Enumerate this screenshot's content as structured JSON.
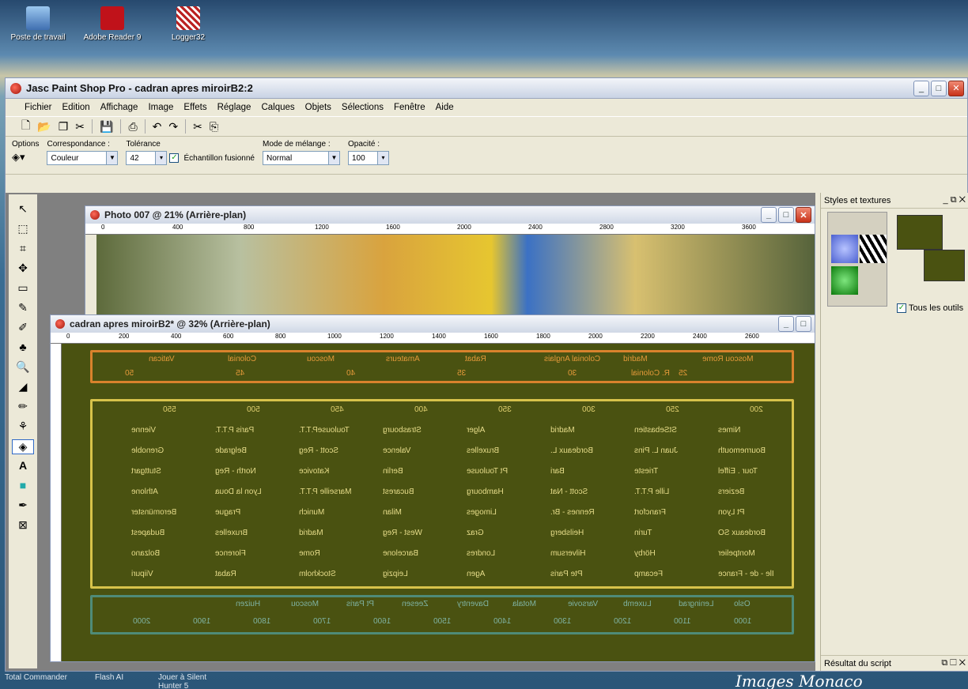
{
  "desktop": {
    "icons": [
      {
        "label": "Poste de travail"
      },
      {
        "label": "Adobe Reader 9"
      },
      {
        "label": "Logger32"
      }
    ],
    "taskbar": [
      "Total Commander",
      "Flash AI",
      "Jouer à Silent Hunter 5"
    ],
    "logo_text": "Images Monaco"
  },
  "app": {
    "title": "Jasc Paint Shop Pro - cadran apres miroirB2:2",
    "menu": [
      "Fichier",
      "Edition",
      "Affichage",
      "Image",
      "Effets",
      "Réglage",
      "Calques",
      "Objets",
      "Sélections",
      "Fenêtre",
      "Aide"
    ],
    "options": {
      "options_label": "Options",
      "match_label": "Correspondance :",
      "match_value": "Couleur",
      "tolerance_label": "Tolérance",
      "tolerance_value": "42",
      "sample_merged": "Échantillon fusionné",
      "blend_label": "Mode de mélange :",
      "blend_value": "Normal",
      "opacity_label": "Opacité :",
      "opacity_value": "100"
    }
  },
  "photo_window": {
    "title": "Photo 007 @  21% (Arrière-plan)",
    "ruler": [
      "0",
      "400",
      "800",
      "1200",
      "1600",
      "2000",
      "2400",
      "2800",
      "3200",
      "3600"
    ]
  },
  "dial_window": {
    "title": "cadran apres miroirB2* @  32% (Arrière-plan)",
    "ruler": [
      "0",
      "200",
      "400",
      "600",
      "800",
      "1000",
      "1200",
      "1400",
      "1600",
      "1800",
      "2000",
      "2200",
      "2400",
      "2600"
    ],
    "top_band": [
      "Moscou Rome",
      "Madrid",
      "Colonial Anglais",
      "Rabat",
      "Amateurs",
      "Moscou",
      "Colonial",
      "Vatican"
    ],
    "top_scale": [
      "25",
      "30",
      "35",
      "40",
      "45",
      "50"
    ],
    "top_extra": "R. Colonial",
    "main_scale": [
      "200",
      "250",
      "300",
      "350",
      "400",
      "450",
      "500",
      "550"
    ],
    "rows": [
      [
        "Nimes",
        "StSebastien",
        "Madrid",
        "Alger",
        "Strasbourg",
        "ToulouseP.T.T.",
        "Paris P.T.T.",
        "Vienne"
      ],
      [
        "Bournemouth",
        "Juan L. Pins",
        "Bordeaux L.",
        "Bruxelles",
        "Valence",
        "Scott - Reg",
        "Belgrade",
        "Grenoble"
      ],
      [
        "Tour . Eiffel",
        "Trieste",
        "Bari",
        "Pt Toulouse",
        "Berlin",
        "Katovice",
        "North - Reg",
        "Stuttgart"
      ],
      [
        "Beziers",
        "Lille P.T.T.",
        "Scott - Nat",
        "Hambourg",
        "Bucarest",
        "Marseille P.T.T.",
        "Lyon la Doua",
        "Athlone"
      ],
      [
        "Pt Lyon",
        "Francfort",
        "Rennes - Br.",
        "Limoges",
        "Milan",
        "Munich",
        "Prague",
        "Beromünster"
      ],
      [
        "Bordeaux SO",
        "Turin",
        "Heilsberg",
        "Graz",
        "West - Reg",
        "Madrid",
        "Bruxelles",
        "Budapest"
      ],
      [
        "Montpelier",
        "Hörby",
        "Hilversum",
        "Londres",
        "Barcelone",
        "Rome",
        "Florence",
        "Bolzano"
      ],
      [
        "Ile - de - France",
        "Fecamp",
        "Pte Paris",
        "Agen",
        "Leipzig",
        "Stockholm",
        "Rabat",
        "Viipuri"
      ]
    ],
    "bottom_band": [
      "Oslo",
      "Leningrad",
      "Luxemb",
      "Varsovie",
      "Motala",
      "Daventry",
      "Zeesen",
      "Pt Paris",
      "Moscou",
      "Huizen"
    ],
    "bottom_scale": [
      "1000",
      "1100",
      "1200",
      "1300",
      "1400",
      "1500",
      "1600",
      "1700",
      "1800",
      "1900",
      "2000"
    ]
  },
  "styles_panel": {
    "title": "Styles et textures",
    "all_tools": "Tous les outils",
    "fg_color": "#4a5211"
  },
  "script_panel": {
    "title": "Résultat du script"
  }
}
